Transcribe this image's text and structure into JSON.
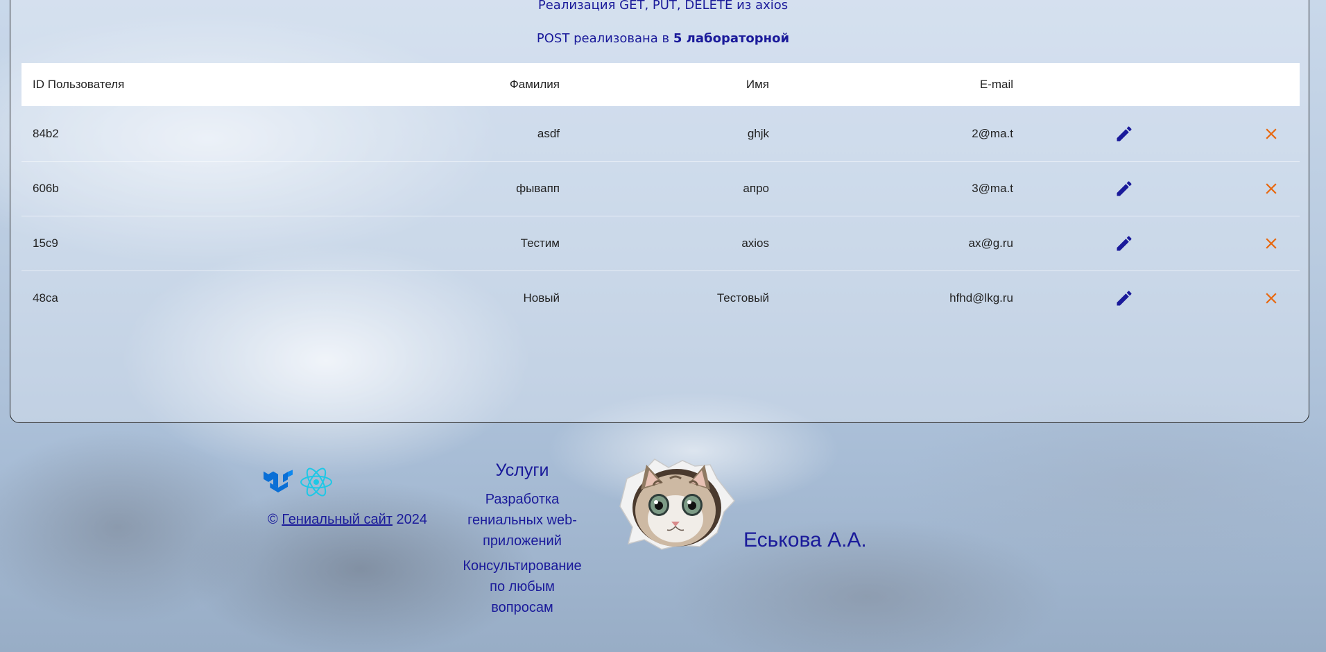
{
  "page": {
    "subtitle_top": "Реализация GET, PUT, DELETE из axios",
    "subtitle_post_prefix": "POST реализована в ",
    "subtitle_post_bold": "5 лабораторной"
  },
  "table": {
    "headers": {
      "id": "ID Пользователя",
      "last_name": "Фамилия",
      "first_name": "Имя",
      "email": "E-mail"
    },
    "rows": [
      {
        "id": "84b2",
        "last_name": "asdf",
        "first_name": "ghjk",
        "email": "2@ma.t"
      },
      {
        "id": "606b",
        "last_name": "фывапп",
        "first_name": "апро",
        "email": "3@ma.t"
      },
      {
        "id": "15c9",
        "last_name": "Тестим",
        "first_name": "axios",
        "email": "ax@g.ru"
      },
      {
        "id": "48ca",
        "last_name": "Новый",
        "first_name": "Тестовый",
        "email": "hfhd@lkg.ru"
      }
    ],
    "edit_icon": "pencil-icon",
    "delete_icon": "close-icon"
  },
  "footer": {
    "copyright_symbol": "©",
    "site_link": "Гениальный сайт",
    "year": "2024",
    "services_title": "Услуги",
    "services": [
      "Разработка гениальных web-приложений",
      "Консультирование по любым вопросам"
    ],
    "author": "Еськова А.А.",
    "logos": [
      "mui-logo",
      "react-logo"
    ],
    "image": "cat-peeking-image"
  },
  "colors": {
    "text_primary": "#1a1a9a",
    "edit_icon": "#1a1a9a",
    "delete_icon": "#e8680f",
    "header_bg": "#ffffff"
  }
}
